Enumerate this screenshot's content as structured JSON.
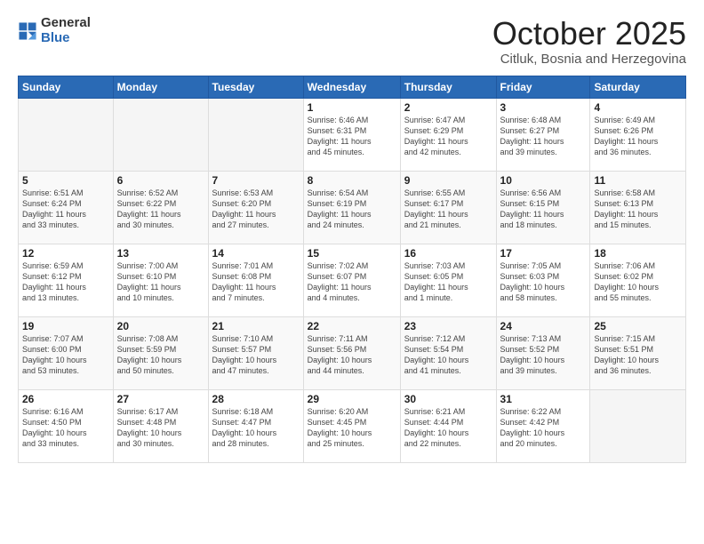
{
  "header": {
    "logo_general": "General",
    "logo_blue": "Blue",
    "month_title": "October 2025",
    "location": "Citluk, Bosnia and Herzegovina"
  },
  "weekdays": [
    "Sunday",
    "Monday",
    "Tuesday",
    "Wednesday",
    "Thursday",
    "Friday",
    "Saturday"
  ],
  "weeks": [
    [
      {
        "day": "",
        "info": ""
      },
      {
        "day": "",
        "info": ""
      },
      {
        "day": "",
        "info": ""
      },
      {
        "day": "1",
        "info": "Sunrise: 6:46 AM\nSunset: 6:31 PM\nDaylight: 11 hours\nand 45 minutes."
      },
      {
        "day": "2",
        "info": "Sunrise: 6:47 AM\nSunset: 6:29 PM\nDaylight: 11 hours\nand 42 minutes."
      },
      {
        "day": "3",
        "info": "Sunrise: 6:48 AM\nSunset: 6:27 PM\nDaylight: 11 hours\nand 39 minutes."
      },
      {
        "day": "4",
        "info": "Sunrise: 6:49 AM\nSunset: 6:26 PM\nDaylight: 11 hours\nand 36 minutes."
      }
    ],
    [
      {
        "day": "5",
        "info": "Sunrise: 6:51 AM\nSunset: 6:24 PM\nDaylight: 11 hours\nand 33 minutes."
      },
      {
        "day": "6",
        "info": "Sunrise: 6:52 AM\nSunset: 6:22 PM\nDaylight: 11 hours\nand 30 minutes."
      },
      {
        "day": "7",
        "info": "Sunrise: 6:53 AM\nSunset: 6:20 PM\nDaylight: 11 hours\nand 27 minutes."
      },
      {
        "day": "8",
        "info": "Sunrise: 6:54 AM\nSunset: 6:19 PM\nDaylight: 11 hours\nand 24 minutes."
      },
      {
        "day": "9",
        "info": "Sunrise: 6:55 AM\nSunset: 6:17 PM\nDaylight: 11 hours\nand 21 minutes."
      },
      {
        "day": "10",
        "info": "Sunrise: 6:56 AM\nSunset: 6:15 PM\nDaylight: 11 hours\nand 18 minutes."
      },
      {
        "day": "11",
        "info": "Sunrise: 6:58 AM\nSunset: 6:13 PM\nDaylight: 11 hours\nand 15 minutes."
      }
    ],
    [
      {
        "day": "12",
        "info": "Sunrise: 6:59 AM\nSunset: 6:12 PM\nDaylight: 11 hours\nand 13 minutes."
      },
      {
        "day": "13",
        "info": "Sunrise: 7:00 AM\nSunset: 6:10 PM\nDaylight: 11 hours\nand 10 minutes."
      },
      {
        "day": "14",
        "info": "Sunrise: 7:01 AM\nSunset: 6:08 PM\nDaylight: 11 hours\nand 7 minutes."
      },
      {
        "day": "15",
        "info": "Sunrise: 7:02 AM\nSunset: 6:07 PM\nDaylight: 11 hours\nand 4 minutes."
      },
      {
        "day": "16",
        "info": "Sunrise: 7:03 AM\nSunset: 6:05 PM\nDaylight: 11 hours\nand 1 minute."
      },
      {
        "day": "17",
        "info": "Sunrise: 7:05 AM\nSunset: 6:03 PM\nDaylight: 10 hours\nand 58 minutes."
      },
      {
        "day": "18",
        "info": "Sunrise: 7:06 AM\nSunset: 6:02 PM\nDaylight: 10 hours\nand 55 minutes."
      }
    ],
    [
      {
        "day": "19",
        "info": "Sunrise: 7:07 AM\nSunset: 6:00 PM\nDaylight: 10 hours\nand 53 minutes."
      },
      {
        "day": "20",
        "info": "Sunrise: 7:08 AM\nSunset: 5:59 PM\nDaylight: 10 hours\nand 50 minutes."
      },
      {
        "day": "21",
        "info": "Sunrise: 7:10 AM\nSunset: 5:57 PM\nDaylight: 10 hours\nand 47 minutes."
      },
      {
        "day": "22",
        "info": "Sunrise: 7:11 AM\nSunset: 5:56 PM\nDaylight: 10 hours\nand 44 minutes."
      },
      {
        "day": "23",
        "info": "Sunrise: 7:12 AM\nSunset: 5:54 PM\nDaylight: 10 hours\nand 41 minutes."
      },
      {
        "day": "24",
        "info": "Sunrise: 7:13 AM\nSunset: 5:52 PM\nDaylight: 10 hours\nand 39 minutes."
      },
      {
        "day": "25",
        "info": "Sunrise: 7:15 AM\nSunset: 5:51 PM\nDaylight: 10 hours\nand 36 minutes."
      }
    ],
    [
      {
        "day": "26",
        "info": "Sunrise: 6:16 AM\nSunset: 4:50 PM\nDaylight: 10 hours\nand 33 minutes."
      },
      {
        "day": "27",
        "info": "Sunrise: 6:17 AM\nSunset: 4:48 PM\nDaylight: 10 hours\nand 30 minutes."
      },
      {
        "day": "28",
        "info": "Sunrise: 6:18 AM\nSunset: 4:47 PM\nDaylight: 10 hours\nand 28 minutes."
      },
      {
        "day": "29",
        "info": "Sunrise: 6:20 AM\nSunset: 4:45 PM\nDaylight: 10 hours\nand 25 minutes."
      },
      {
        "day": "30",
        "info": "Sunrise: 6:21 AM\nSunset: 4:44 PM\nDaylight: 10 hours\nand 22 minutes."
      },
      {
        "day": "31",
        "info": "Sunrise: 6:22 AM\nSunset: 4:42 PM\nDaylight: 10 hours\nand 20 minutes."
      },
      {
        "day": "",
        "info": ""
      }
    ]
  ]
}
